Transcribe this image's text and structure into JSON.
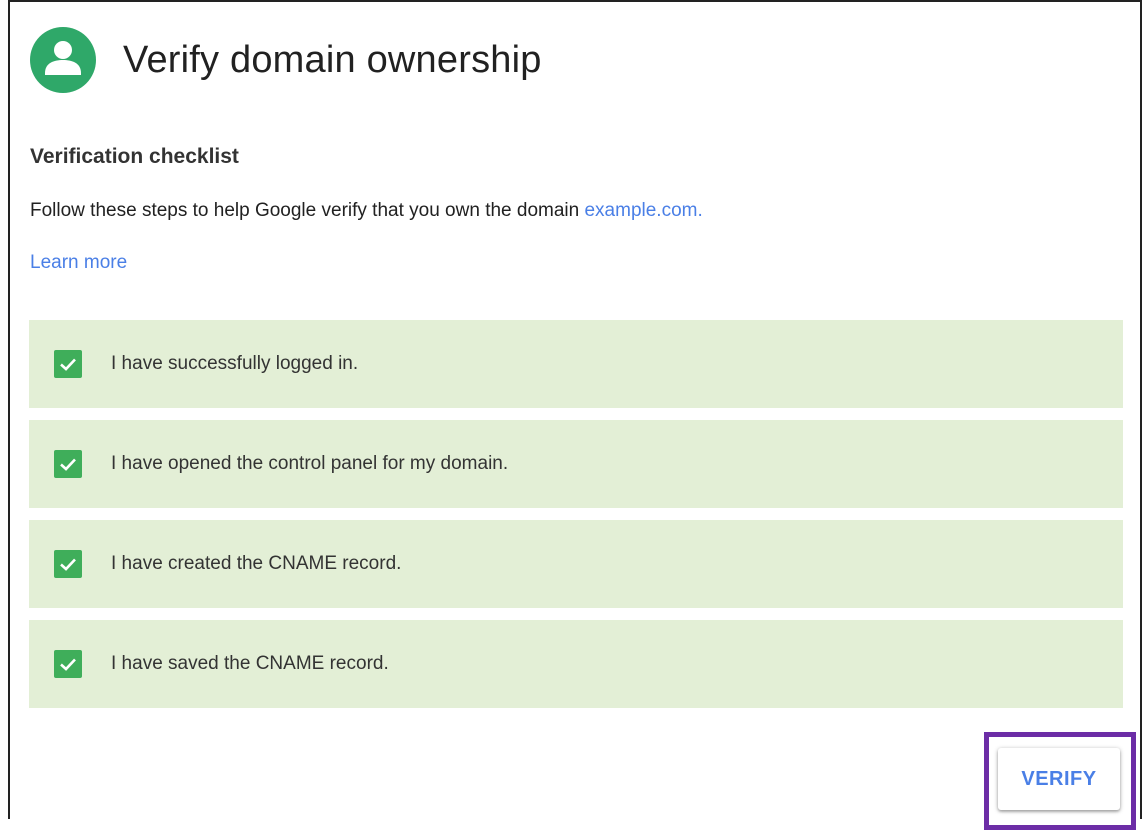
{
  "header": {
    "title": "Verify domain ownership",
    "avatar_icon": "person-icon",
    "avatar_color": "#2fa869"
  },
  "checklist": {
    "heading": "Verification checklist",
    "description": "Follow these steps to help Google verify that you own the domain",
    "domain_link": "example.com.",
    "learn_more": "Learn more",
    "items": [
      {
        "label": "I have successfully logged in.",
        "checked": true
      },
      {
        "label": "I have opened the control panel for my domain.",
        "checked": true
      },
      {
        "label": "I have created the CNAME record.",
        "checked": true
      },
      {
        "label": "I have saved the CNAME record.",
        "checked": true
      }
    ],
    "item_background": "#e3efd6",
    "checkbox_color": "#3fae5a"
  },
  "actions": {
    "verify_label": "VERIFY",
    "verify_color": "#4a7fe6",
    "highlight_color": "#6c2da6"
  }
}
